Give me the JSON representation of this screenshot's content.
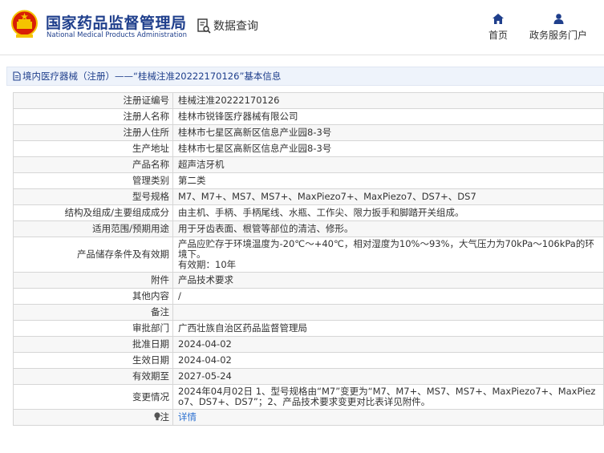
{
  "header": {
    "site_name_cn": "国家药品监督管理局",
    "site_name_en": "National Medical Products Administration",
    "query_label": "数据查询",
    "nav": [
      {
        "label": "首页",
        "icon": "home-icon"
      },
      {
        "label": "政务服务门户",
        "icon": "user-icon"
      }
    ]
  },
  "page_title": "境内医疗器械（注册）——“桂械注准20222170126”基本信息",
  "colors": {
    "brand_blue": "#1f3f8c",
    "link_blue": "#2a6fd0",
    "emblem_red": "#d81e06",
    "emblem_gold": "#f5c400"
  },
  "details": [
    {
      "label": "注册证编号",
      "value": "桂械注准20222170126"
    },
    {
      "label": "注册人名称",
      "value": "桂林市锐锋医疗器械有限公司"
    },
    {
      "label": "注册人住所",
      "value": "桂林市七星区高新区信息产业园8-3号"
    },
    {
      "label": "生产地址",
      "value": "桂林市七星区高新区信息产业园8-3号"
    },
    {
      "label": "产品名称",
      "value": "超声洁牙机"
    },
    {
      "label": "管理类别",
      "value": "第二类"
    },
    {
      "label": "型号规格",
      "value": "M7、M7+、MS7、MS7+、MaxPiezo7+、MaxPiezo7、DS7+、DS7"
    },
    {
      "label": "结构及组成/主要组成成分",
      "value": "由主机、手柄、手柄尾线、水瓶、工作尖、限力扳手和脚踏开关组成。"
    },
    {
      "label": "适用范围/预期用途",
      "value": "用于牙齿表面、根管等部位的清洁、修形。"
    },
    {
      "label": "产品储存条件及有效期",
      "value": "产品应贮存于环境温度为-20℃～+40℃，相对湿度为10%～93%，大气压力为70kPa～106kPa的环境下。",
      "value2": "有效期：10年"
    },
    {
      "label": "附件",
      "value": "产品技术要求"
    },
    {
      "label": "其他内容",
      "value": "/"
    },
    {
      "label": "备注",
      "value": ""
    },
    {
      "label": "审批部门",
      "value": "广西壮族自治区药品监督管理局"
    },
    {
      "label": "批准日期",
      "value": "2024-04-02"
    },
    {
      "label": "生效日期",
      "value": "2024-04-02"
    },
    {
      "label": "有效期至",
      "value": "2027-05-24"
    },
    {
      "label": "变更情况",
      "value": "2024年04月02日 1、型号规格由“M7”变更为“M7、M7+、MS7、MS7+、MaxPiezo7+、MaxPiezo7、DS7+、DS7”；2、产品技术要求变更对比表详见附件。"
    },
    {
      "label": "注",
      "value": "详情",
      "icon": "lightbulb-icon"
    }
  ]
}
